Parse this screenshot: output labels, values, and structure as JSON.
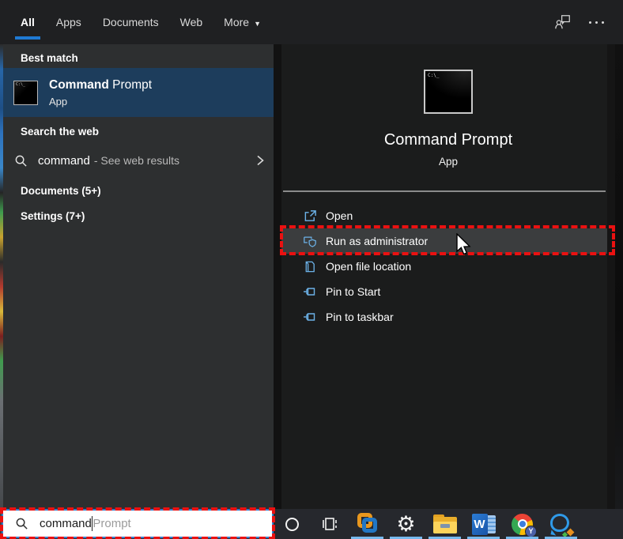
{
  "tabs": {
    "items": [
      {
        "label": "All"
      },
      {
        "label": "Apps"
      },
      {
        "label": "Documents"
      },
      {
        "label": "Web"
      },
      {
        "label": "More"
      }
    ]
  },
  "left_panel": {
    "best_match": {
      "header": "Best match",
      "result": {
        "name_match": "Command",
        "name_rest": " Prompt",
        "type": "App"
      }
    },
    "search_web": {
      "header": "Search the web",
      "query": "command",
      "suffix": "- See web results"
    },
    "documents": {
      "header": "Documents (5+)"
    },
    "settings": {
      "header": "Settings (7+)"
    }
  },
  "preview_panel": {
    "app_name": "Command Prompt",
    "app_type": "App",
    "actions": [
      {
        "label": "Open",
        "icon": "open-icon",
        "highlighted": false
      },
      {
        "label": "Run as administrator",
        "icon": "shield-icon",
        "highlighted": true
      },
      {
        "label": "Open file location",
        "icon": "file-location-icon",
        "highlighted": false
      },
      {
        "label": "Pin to Start",
        "icon": "pin-icon",
        "highlighted": false
      },
      {
        "label": "Pin to taskbar",
        "icon": "pin-icon",
        "highlighted": false
      }
    ]
  },
  "search_box": {
    "value": "command",
    "suggestion": "Prompt"
  },
  "cmd_icon_text": "C:\\_",
  "taskbar": {
    "icons": [
      "cortana-icon",
      "task-view-icon",
      "vmware-icon",
      "settings-gear-icon",
      "file-explorer-icon",
      "word-icon",
      "chrome-icon",
      "chat-app-icon"
    ]
  },
  "colors": {
    "accent_blue": "#1f7ad4",
    "selection_blue": "#1d3d5c",
    "action_icon_blue": "#6cb2e8",
    "annotation_red": "#ea1111",
    "taskbar_underline": "#76b9ed"
  }
}
